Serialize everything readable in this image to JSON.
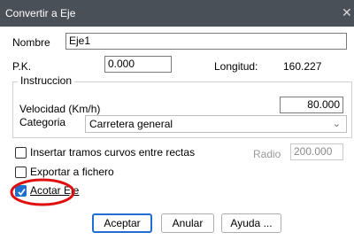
{
  "window": {
    "title": "Convertir a Eje",
    "close_glyph": "✕"
  },
  "nombre": {
    "label": "Nombre",
    "value": "Eje1"
  },
  "pk": {
    "label": "P.K.",
    "value": "0.000"
  },
  "longitud": {
    "label": "Longitud:",
    "value": "160.227"
  },
  "instruccion": {
    "group_label": "Instruccion",
    "velocidad_label": "Velocidad (Km/h)",
    "velocidad_value": "80.000",
    "categoria_label": "Categoria",
    "categoria_value": "Carretera general"
  },
  "options": {
    "insertar_label": "Insertar tramos curvos entre rectas",
    "insertar_checked": false,
    "radio_label": "Radio",
    "radio_value": "200.000",
    "exportar_label": "Exportar a fichero",
    "exportar_checked": false,
    "acotar_label": "Acotar Eje",
    "acotar_checked": true
  },
  "buttons": {
    "aceptar": "Aceptar",
    "anular": "Anular",
    "ayuda": "Ayuda ..."
  },
  "colors": {
    "titlebar": "#4a5058",
    "accent": "#1f6fd1",
    "annotation": "#e01010"
  },
  "icons": {
    "close": "close-icon",
    "dropdown": "chevron-down-icon",
    "check": "checkmark-icon"
  }
}
